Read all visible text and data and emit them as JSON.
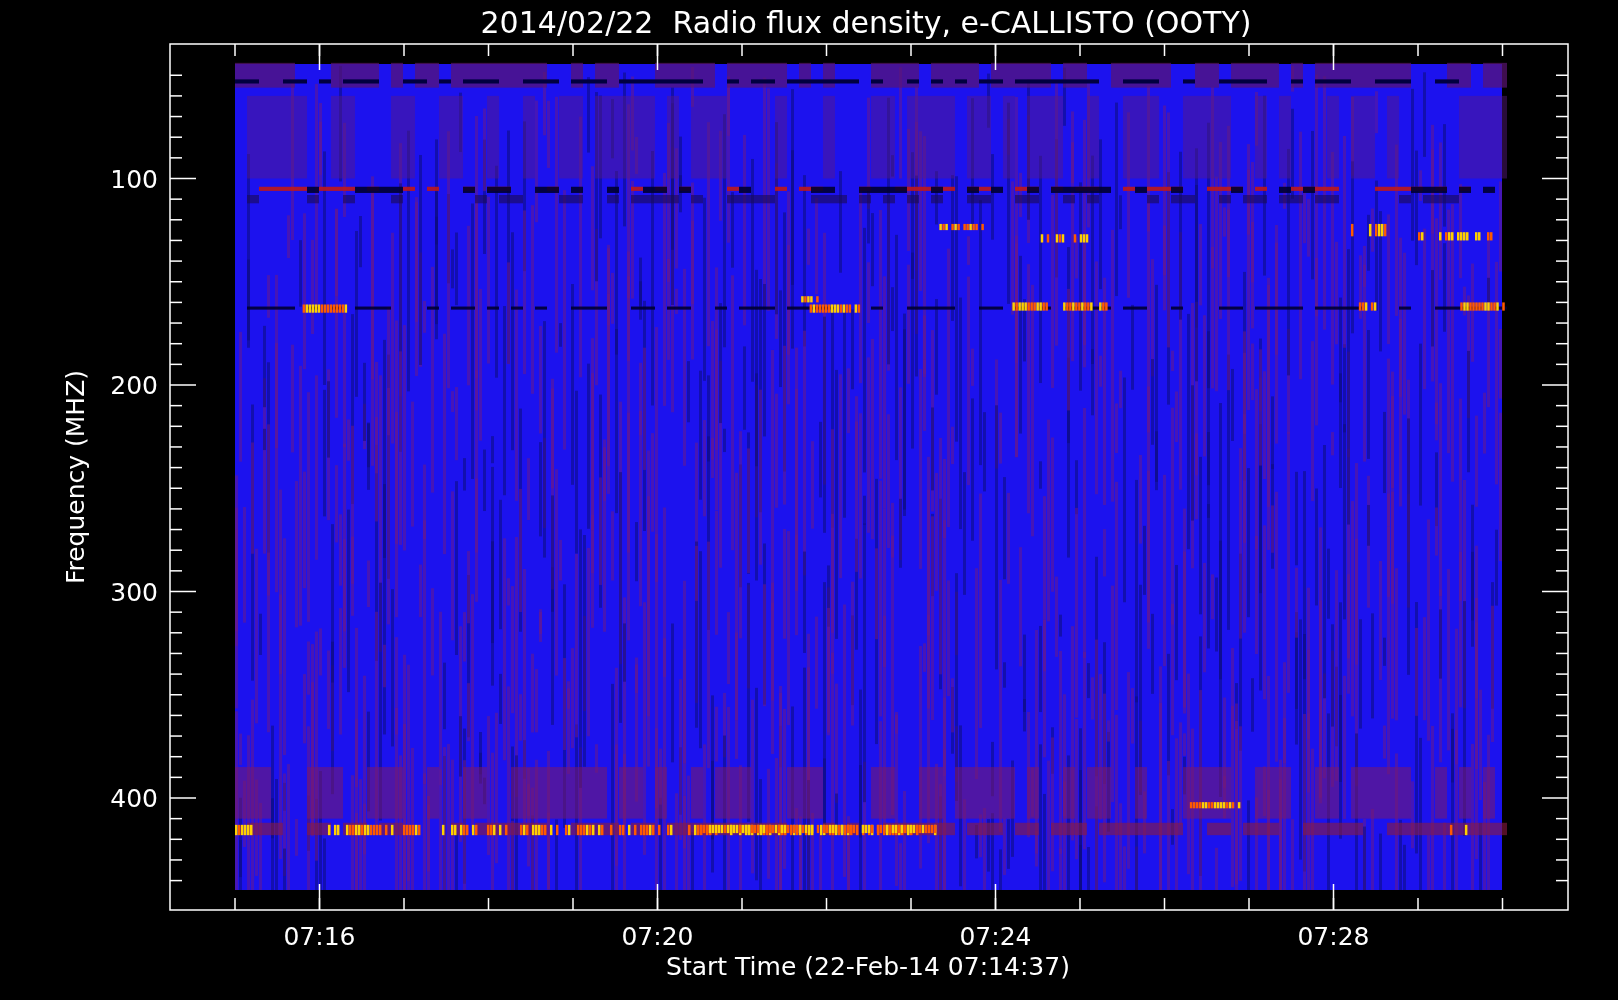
{
  "title": "2014/02/22  Radio flux density, e-CALLISTO (OOTY)",
  "y_axis": {
    "label": "Frequency (MHZ)",
    "ticks": [
      "100",
      "200",
      "300",
      "400"
    ]
  },
  "x_axis": {
    "label": "Start Time (22-Feb-14 07:14:37)",
    "ticks": [
      "07:16",
      "07:20",
      "07:24",
      "07:28"
    ]
  }
}
